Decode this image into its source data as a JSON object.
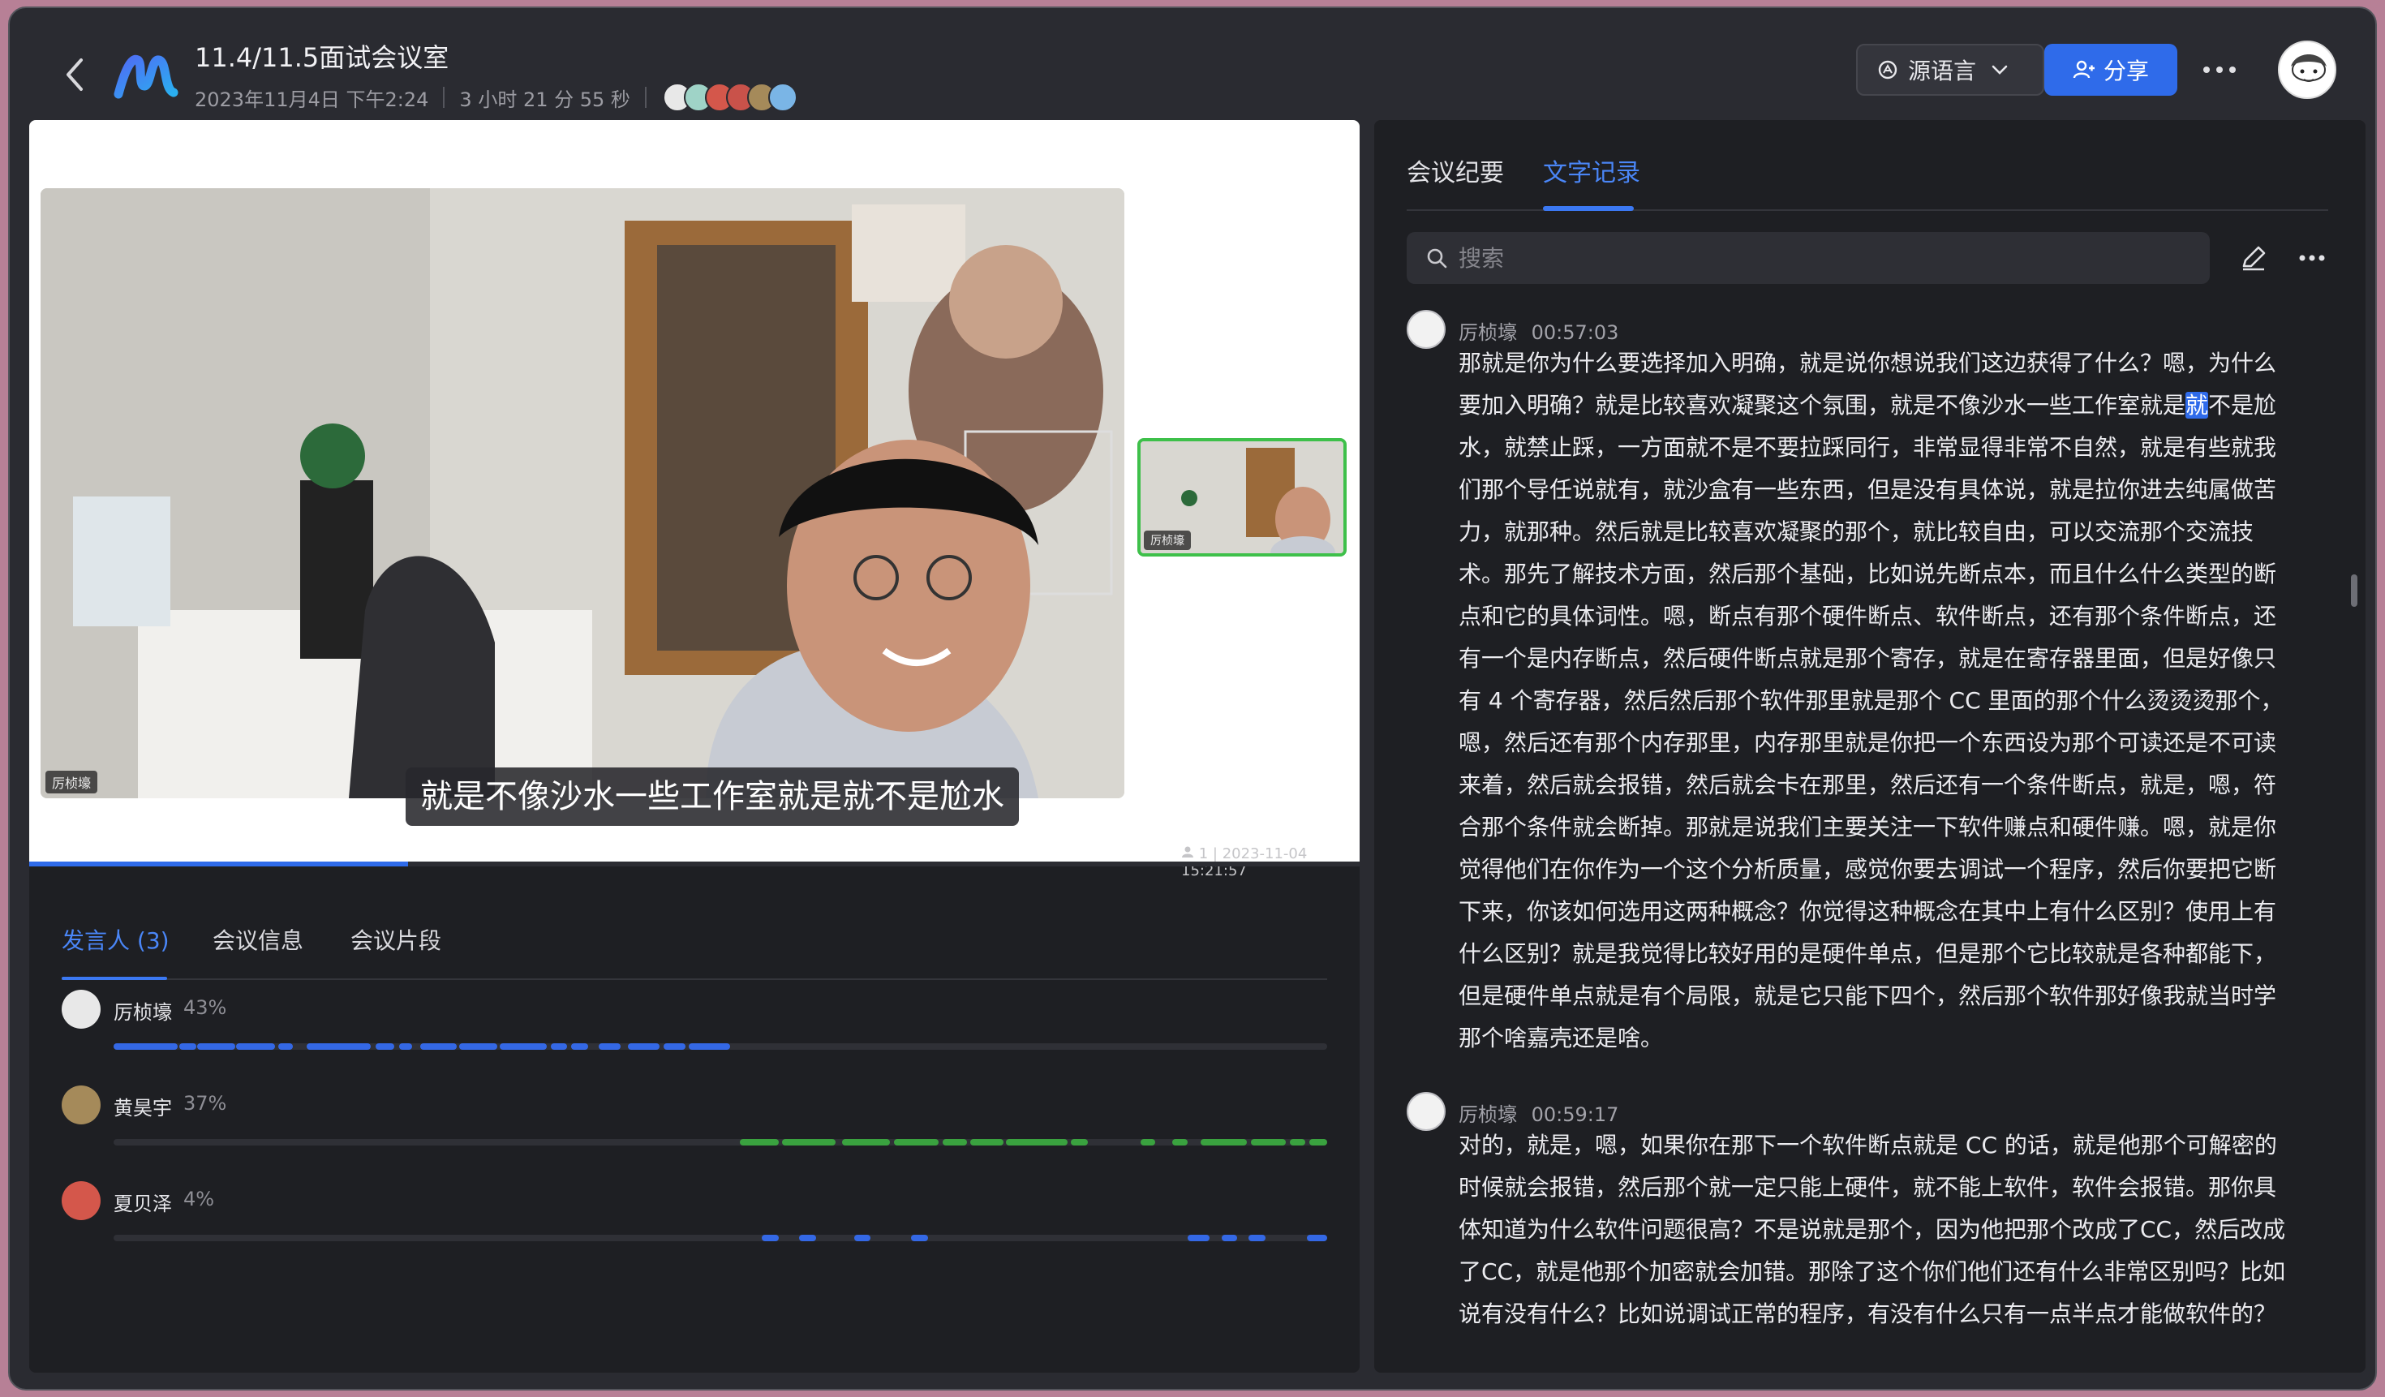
{
  "header": {
    "title": "11.4/11.5面试会议室",
    "date": "2023年11月4日 下午2:24",
    "duration": "3 小时 21 分 55 秒",
    "lang_button": "源语言",
    "share_button": "分享"
  },
  "video": {
    "main_name_tag": "厉桢壕",
    "thumb_name_tag": "厉桢壕",
    "subtitle": "就是不像沙水一些工作室就是就不是尬水",
    "stamp": "1 | 2023-11-04 15:21:57",
    "progress": 0.285
  },
  "left_tabs": [
    "发言人 (3)",
    "会议信息",
    "会议片段"
  ],
  "speakers": [
    {
      "name": "厉桢壕",
      "percent": "43%",
      "color": "#3468e5",
      "avatar_color": "#e8e8e8",
      "segments": [
        [
          0.0,
          0.053
        ],
        [
          0.054,
          0.068
        ],
        [
          0.069,
          0.1
        ],
        [
          0.101,
          0.133
        ],
        [
          0.136,
          0.148
        ],
        [
          0.159,
          0.212
        ],
        [
          0.216,
          0.231
        ],
        [
          0.235,
          0.246
        ],
        [
          0.253,
          0.283
        ],
        [
          0.285,
          0.316
        ],
        [
          0.318,
          0.357
        ],
        [
          0.36,
          0.374
        ],
        [
          0.377,
          0.391
        ],
        [
          0.4,
          0.418
        ],
        [
          0.424,
          0.45
        ],
        [
          0.453,
          0.471
        ],
        [
          0.474,
          0.508
        ]
      ]
    },
    {
      "name": "黄昊宇",
      "percent": "37%",
      "color": "#3aa23f",
      "avatar_color": "#a58a5a",
      "segments": [
        [
          0.516,
          0.548
        ],
        [
          0.551,
          0.595
        ],
        [
          0.6,
          0.64
        ],
        [
          0.643,
          0.68
        ],
        [
          0.683,
          0.703
        ],
        [
          0.706,
          0.733
        ],
        [
          0.735,
          0.786
        ],
        [
          0.789,
          0.803
        ],
        [
          0.846,
          0.858
        ],
        [
          0.872,
          0.885
        ],
        [
          0.896,
          0.934
        ],
        [
          0.937,
          0.966
        ],
        [
          0.969,
          0.982
        ],
        [
          0.985,
          1.0
        ]
      ]
    },
    {
      "name": "夏贝泽",
      "percent": "4%",
      "color": "#3468e5",
      "avatar_color": "#d4574b",
      "segments": [
        [
          0.534,
          0.548
        ],
        [
          0.565,
          0.579
        ],
        [
          0.61,
          0.624
        ],
        [
          0.657,
          0.671
        ],
        [
          0.885,
          0.903
        ],
        [
          0.913,
          0.926
        ],
        [
          0.935,
          0.949
        ],
        [
          0.983,
          1.0
        ]
      ]
    }
  ],
  "right_tabs": [
    "会议纪要",
    "文字记录"
  ],
  "search": {
    "placeholder": "搜索"
  },
  "transcript": [
    {
      "speaker": "厉桢壕",
      "time": "00:57:03",
      "text_before": "那就是你为什么要选择加入明确，就是说你想说我们这边获得了什么？嗯，为什么要加入明确？就是比较喜欢凝聚这个氛围，就是不像沙水一些工作室就是",
      "highlight": "就",
      "text_after": "不是尬水，就禁止踩，一方面就不是不要拉踩同行，非常显得非常不自然，就是有些就我们那个导任说就有，就沙盒有一些东西，但是没有具体说，就是拉你进去纯属做苦力，就那种。然后就是比较喜欢凝聚的那个，就比较自由，可以交流那个交流技术。那先了解技术方面，然后那个基础，比如说先断点本，而且什么什么类型的断点和它的具体词性。嗯，断点有那个硬件断点、软件断点，还有那个条件断点，还有一个是内存断点，然后硬件断点就是那个寄存，就是在寄存器里面，但是好像只有 4 个寄存器，然后然后那个软件那里就是那个 CC 里面的那个什么烫烫烫那个，嗯，然后还有那个内存那里，内存那里就是你把一个东西设为那个可读还是不可读来着，然后就会报错，然后就会卡在那里，然后还有一个条件断点，就是，嗯，符合那个条件就会断掉。那就是说我们主要关注一下软件赚点和硬件赚。嗯，就是你觉得他们在你作为一个这个分析质量，感觉你要去调试一个程序，然后你要把它断下来，你该如何选用这两种概念？你觉得这种概念在其中上有什么区别？使用上有什么区别？就是我觉得比较好用的是硬件单点，但是那个它比较就是各种都能下，但是硬件单点就是有个局限，就是它只能下四个，然后那个软件那好像我就当时学那个啥嘉壳还是啥。"
    },
    {
      "speaker": "厉桢壕",
      "time": "00:59:17",
      "text": "对的，就是，嗯，如果你在那下一个软件断点就是 CC 的话，就是他那个可解密的时候就会报错，然后那个就一定只能上硬件，就不能上软件，软件会报错。那你具体知道为什么软件问题很高？不是说就是那个，因为他把那个改成了CC，然后改成了CC，就是他那个加密就会加错。那除了这个你们他们还有什么非常区别吗？比如说有没有什么？比如说调试正常的程序，有没有什么只有一点半点才能做软件的？"
    }
  ],
  "colors": {
    "accent": "#2f6bea",
    "green": "#3aa23f",
    "bg": "#2a2b31",
    "panel": "#1e1f23"
  }
}
